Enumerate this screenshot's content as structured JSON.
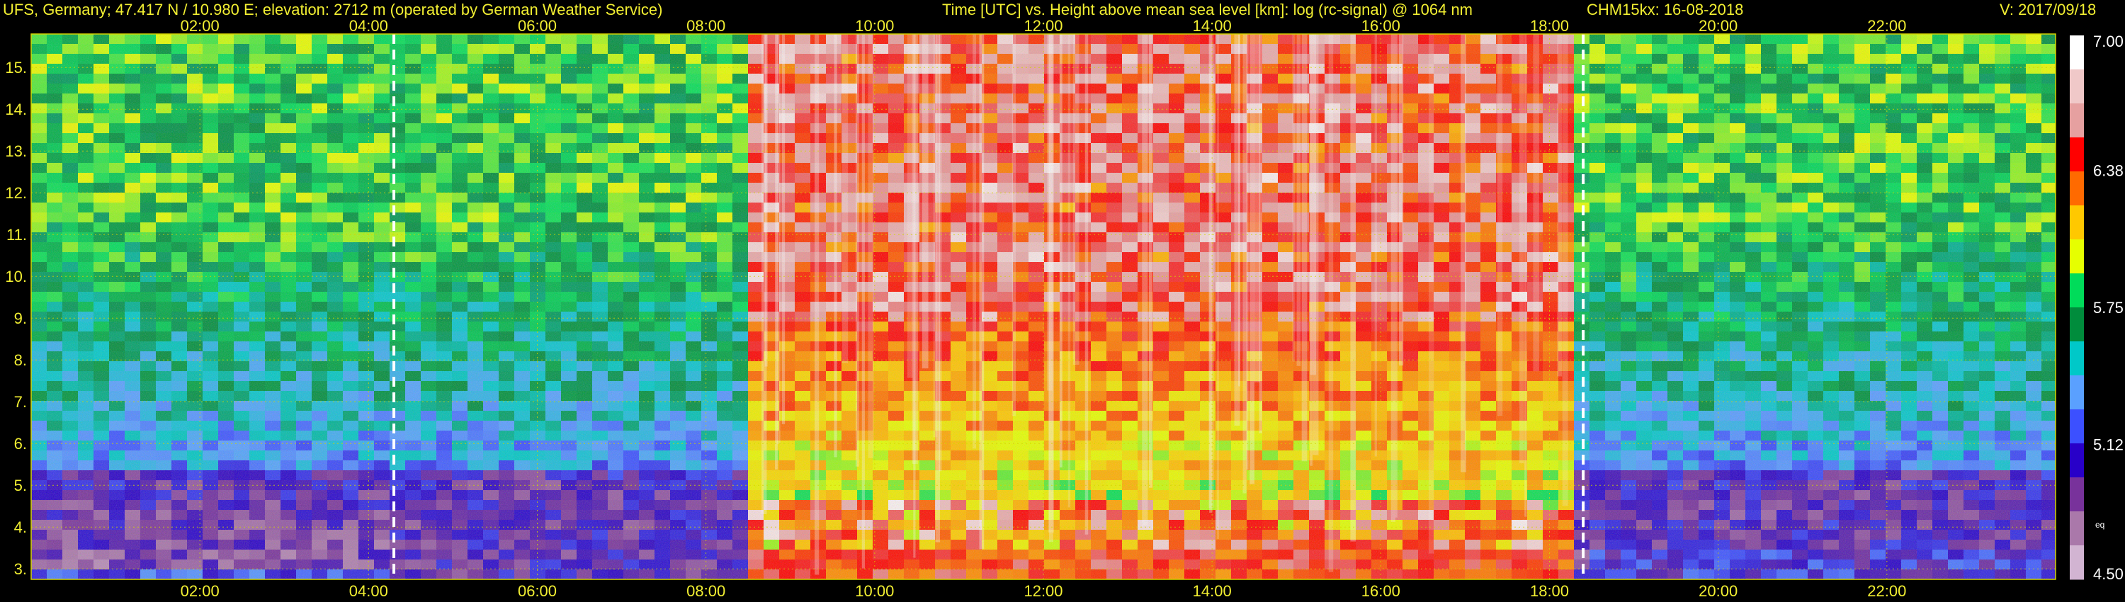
{
  "header": {
    "station": "UFS, Germany; 47.417 N / 10.980 E; elevation: 2712 m  (operated by German Weather Service)",
    "axis_desc": "Time [UTC] vs. Height above mean sea level [km]: log (rc-signal) @ 1064 nm",
    "instrument": "CHM15kx: 16-08-2018",
    "version": "V: 2017/09/18"
  },
  "colorbar": {
    "ticks": [
      "7.00",
      "6.38",
      "5.75",
      "5.12",
      "4.50"
    ],
    "small_label": "eq",
    "colors": [
      "#ffffff",
      "#f0c8c8",
      "#e6a0a0",
      "#ff0000",
      "#ff6a00",
      "#ffc800",
      "#e6ff00",
      "#00dc5a",
      "#008c3c",
      "#00c8c8",
      "#5aa0ff",
      "#3c50ff",
      "#2800c8",
      "#78329b",
      "#aa78aa",
      "#d2b4d2"
    ]
  },
  "chart_data": {
    "type": "heatmap",
    "title": "Time [UTC] vs. Height above mean sea level [km]: log (rc-signal) @ 1064 nm",
    "xlabel": "Time [UTC]",
    "ylabel": "Height above mean sea level [km]",
    "x_ticks": [
      "02:00",
      "04:00",
      "06:00",
      "08:00",
      "10:00",
      "12:00",
      "14:00",
      "16:00",
      "18:00",
      "20:00",
      "22:00"
    ],
    "x_tick_hours": [
      2,
      4,
      6,
      8,
      10,
      12,
      14,
      16,
      18,
      20,
      22
    ],
    "y_ticks": [
      "3.",
      "4.",
      "5.",
      "6.",
      "7.",
      "8.",
      "9.",
      "10.",
      "11.",
      "12.",
      "13.",
      "14.",
      "15."
    ],
    "y_tick_values": [
      3,
      4,
      5,
      6,
      7,
      8,
      9,
      10,
      11,
      12,
      13,
      14,
      15
    ],
    "xlim": [
      0,
      24
    ],
    "ylim": [
      2.75,
      15.8
    ],
    "zlim": [
      4.5,
      7.0
    ],
    "grid": true,
    "vertical_markers_hours": [
      4.3,
      18.4
    ],
    "colorbar_label": "log (rc-signal)"
  }
}
